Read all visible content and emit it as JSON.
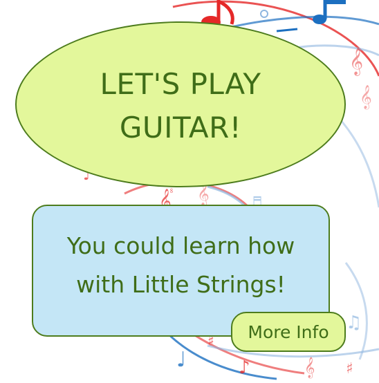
{
  "hero": {
    "title": "LET'S PLAY GUITAR!"
  },
  "info": {
    "text": "You could learn how with Little Strings!"
  },
  "actions": {
    "more_info_label": "More Info"
  },
  "background": {
    "icons": [
      "music-notes-swirl-art"
    ]
  },
  "colors": {
    "accent_green": "#e3f79b",
    "text_green": "#3f6d18",
    "border_green": "#4d7c1d",
    "info_blue": "#c4e6f6",
    "note_red": "#e52828",
    "note_blue": "#1c6fc0"
  }
}
